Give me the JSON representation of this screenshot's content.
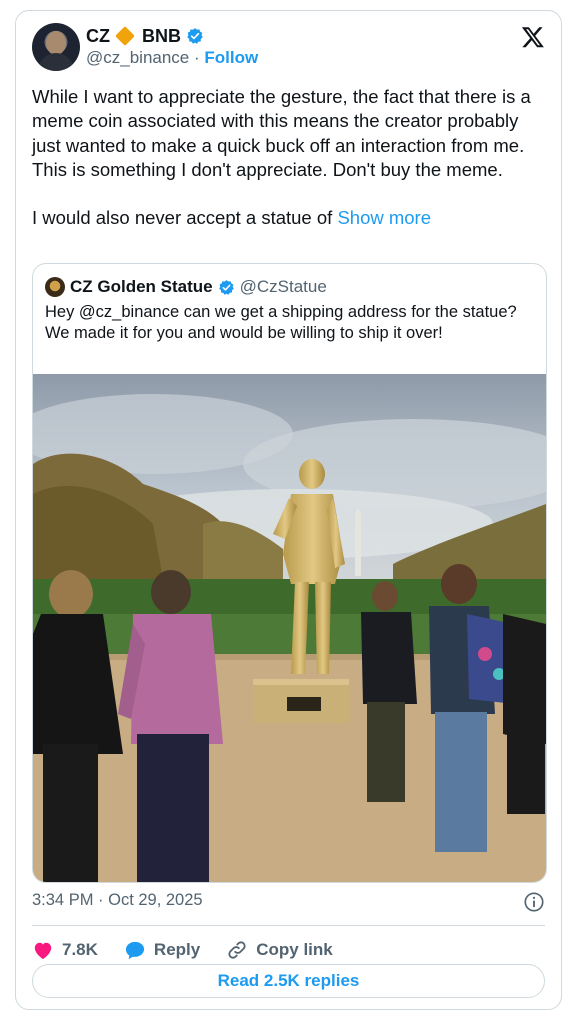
{
  "author": {
    "name": "CZ",
    "name_suffix": "BNB",
    "handle": "@cz_binance",
    "separator": "·",
    "follow_label": "Follow",
    "verified": true
  },
  "tweet": {
    "paragraph1": "While I want to appreciate the gesture, the fact that there is a meme coin associated with this means the creator probably just wanted to make a quick buck off an interaction from me. This is something I don't appreciate. Don't buy the meme.",
    "paragraph2": "I would also never accept a statue of",
    "show_more": "Show more"
  },
  "quote": {
    "name": "CZ Golden Statue",
    "handle": "@CzStatue",
    "text": "Hey @cz_binance can we get a shipping address for the statue? We made it for you and would be willing to ship it over!",
    "image_alt": "Golden statue on a lawn with people looking at it and an obelisk in the distance"
  },
  "meta": {
    "timestamp": "3:34 PM · Oct 29, 2025"
  },
  "actions": {
    "likes": "7.8K",
    "reply_label": "Reply",
    "copy_link_label": "Copy link",
    "read_replies_label": "Read 2.5K replies"
  },
  "colors": {
    "accent": "#1d9bf0",
    "like": "#f91880",
    "diamond": "#f0a30a",
    "text": "#0f1419",
    "muted": "#536471",
    "border": "#cfd9de"
  },
  "icons": [
    "diamond-icon",
    "verified-icon",
    "x-logo-icon",
    "info-icon",
    "heart-icon",
    "reply-icon",
    "link-icon"
  ]
}
